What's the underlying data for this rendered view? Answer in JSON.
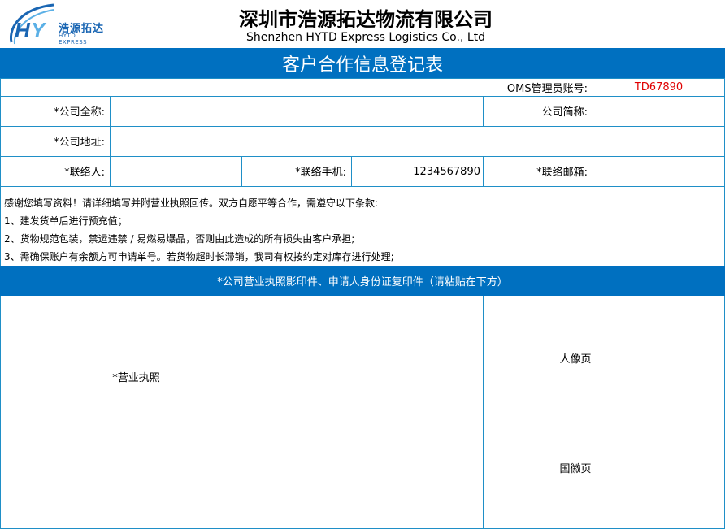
{
  "header": {
    "logo_cn": "浩源拓达",
    "logo_en": "HYTD EXPRESS",
    "company_cn": "深圳市浩源拓达物流有限公司",
    "company_en": "Shenzhen HYTD Express Logistics Co., Ltd"
  },
  "form": {
    "title": "客户合作信息登记表",
    "oms_label": "OMS管理员账号:",
    "oms_value": "TD67890",
    "oms_value_color": "#e00000",
    "company_full_label": "*公司全称:",
    "company_full_value": "",
    "company_short_label": "公司简称:",
    "company_short_value": "",
    "address_label": "*公司地址:",
    "address_value": "",
    "contact_label": "*联络人:",
    "contact_value": "",
    "mobile_label": "*联络手机:",
    "mobile_value": "1234567890",
    "email_label": "*联络邮箱:",
    "email_value": ""
  },
  "terms": [
    "感谢您填写资料！请详细填写并附营业执照回传。双方自愿平等合作，需遵守以下条款:",
    "1、建发货单后进行预充值；",
    "2、货物规范包装，禁运违禁 / 易燃易爆品，否则由此造成的所有损失由客户承担;",
    "3、需确保账户有余额方可申请单号。若货物超时长滞销，我司有权按约定对库存进行处理;"
  ],
  "upload": {
    "banner": "*公司营业执照影印件、申请人身份证复印件（请粘贴在下方）",
    "license_label": "*营业执照",
    "id_front_label": "人像页",
    "id_back_label": "国徽页"
  },
  "colors": {
    "accent": "#0070c0",
    "grid": "#1f8fc7"
  }
}
